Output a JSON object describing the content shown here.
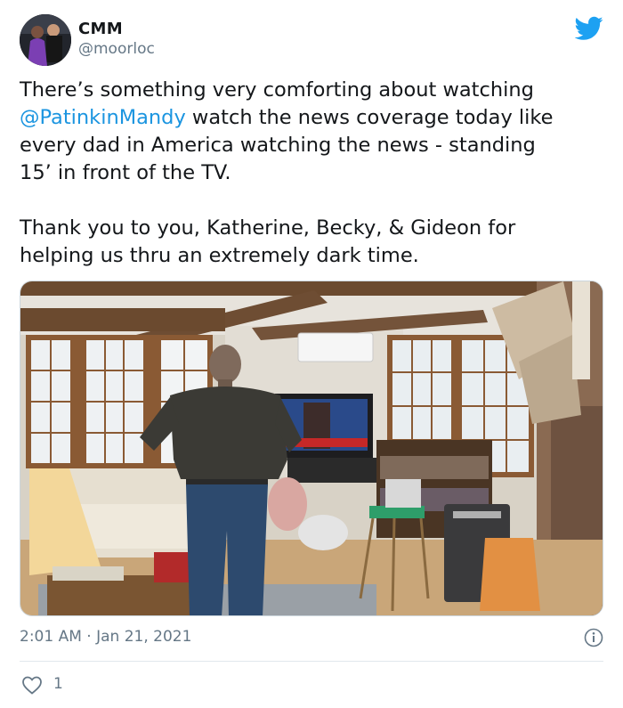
{
  "author": {
    "display_name": "CMM",
    "handle": "@moorloc"
  },
  "tweet": {
    "line1_before": "There’s something very comforting about watching",
    "mention": "@PatinkinMandy",
    "line2_after": " watch the news coverage today like",
    "line3": "every dad in America watching the news - standing",
    "line4": "15’ in front of the TV.",
    "line5": "Thank you to you, Katherine, Becky, & Gideon for",
    "line6": "helping us thru an extremely dark time."
  },
  "meta": {
    "timestamp": "2:01 AM · Jan 21, 2021",
    "like_count": "1"
  },
  "icons": {
    "brand": "twitter-bird-icon",
    "info": "info-icon",
    "like": "heart-icon"
  },
  "colors": {
    "brand_blue": "#1da1f2",
    "mention_blue": "#1b95e0",
    "secondary_text": "#657786"
  }
}
